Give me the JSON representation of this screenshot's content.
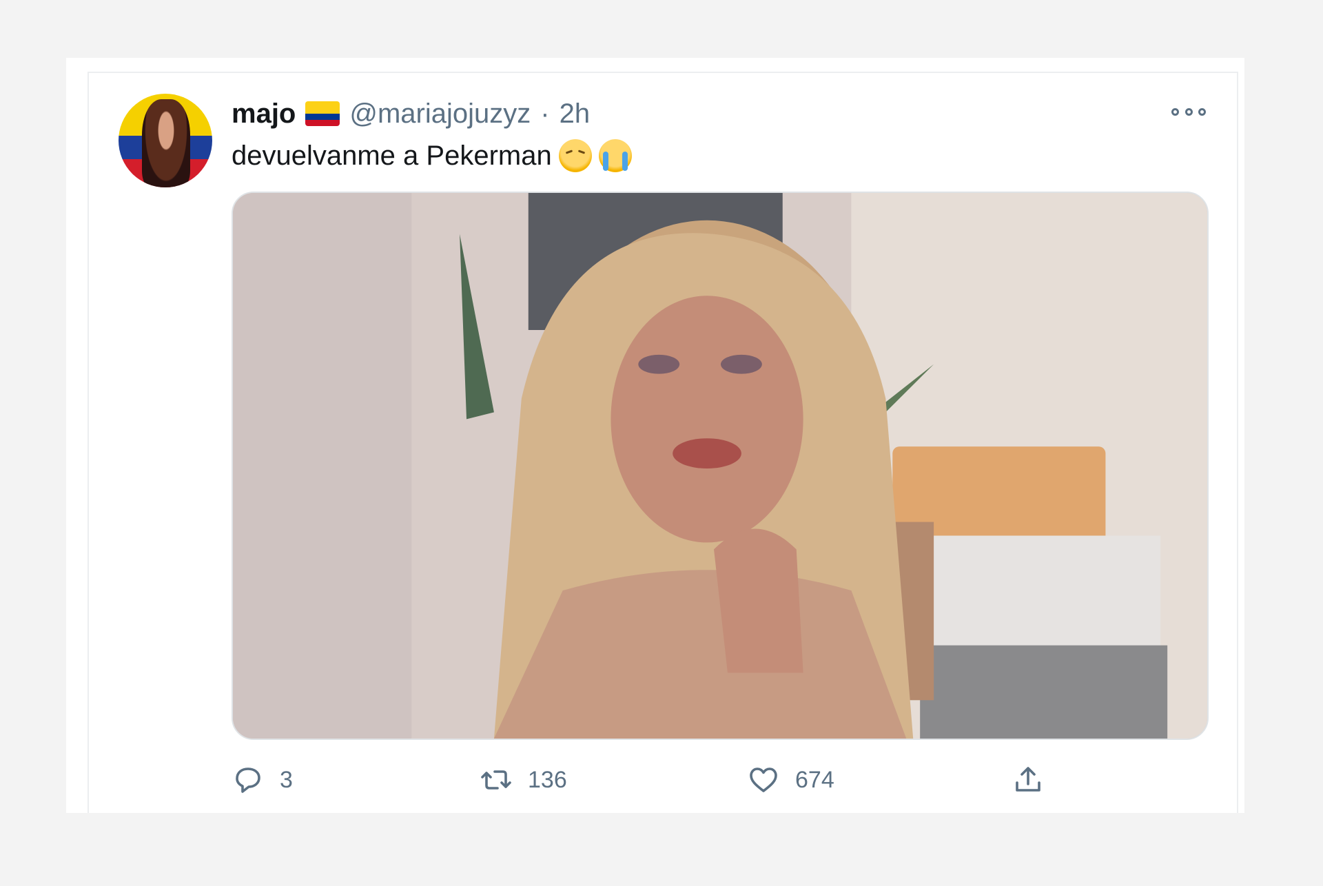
{
  "tweet": {
    "display_name": "majo",
    "handle": "@mariajojuzyz",
    "separator": "·",
    "time": "2h",
    "text": "devuelvanme a Pekerman",
    "emojis": [
      "pensive-face-emoji",
      "loudly-crying-face-emoji"
    ],
    "media_description_icon": "image",
    "actions": {
      "reply_count": "3",
      "retweet_count": "136",
      "like_count": "674"
    }
  },
  "colors": {
    "text_primary": "#14171a",
    "text_secondary": "#5b7083",
    "border": "#eceef0",
    "page_background": "#f3f3f3"
  },
  "icons": {
    "more": "more-horizontal-icon",
    "reply": "reply-bubble-icon",
    "retweet": "retweet-icon",
    "like": "heart-icon",
    "share": "share-upload-icon",
    "flag": "colombia-flag-icon"
  }
}
